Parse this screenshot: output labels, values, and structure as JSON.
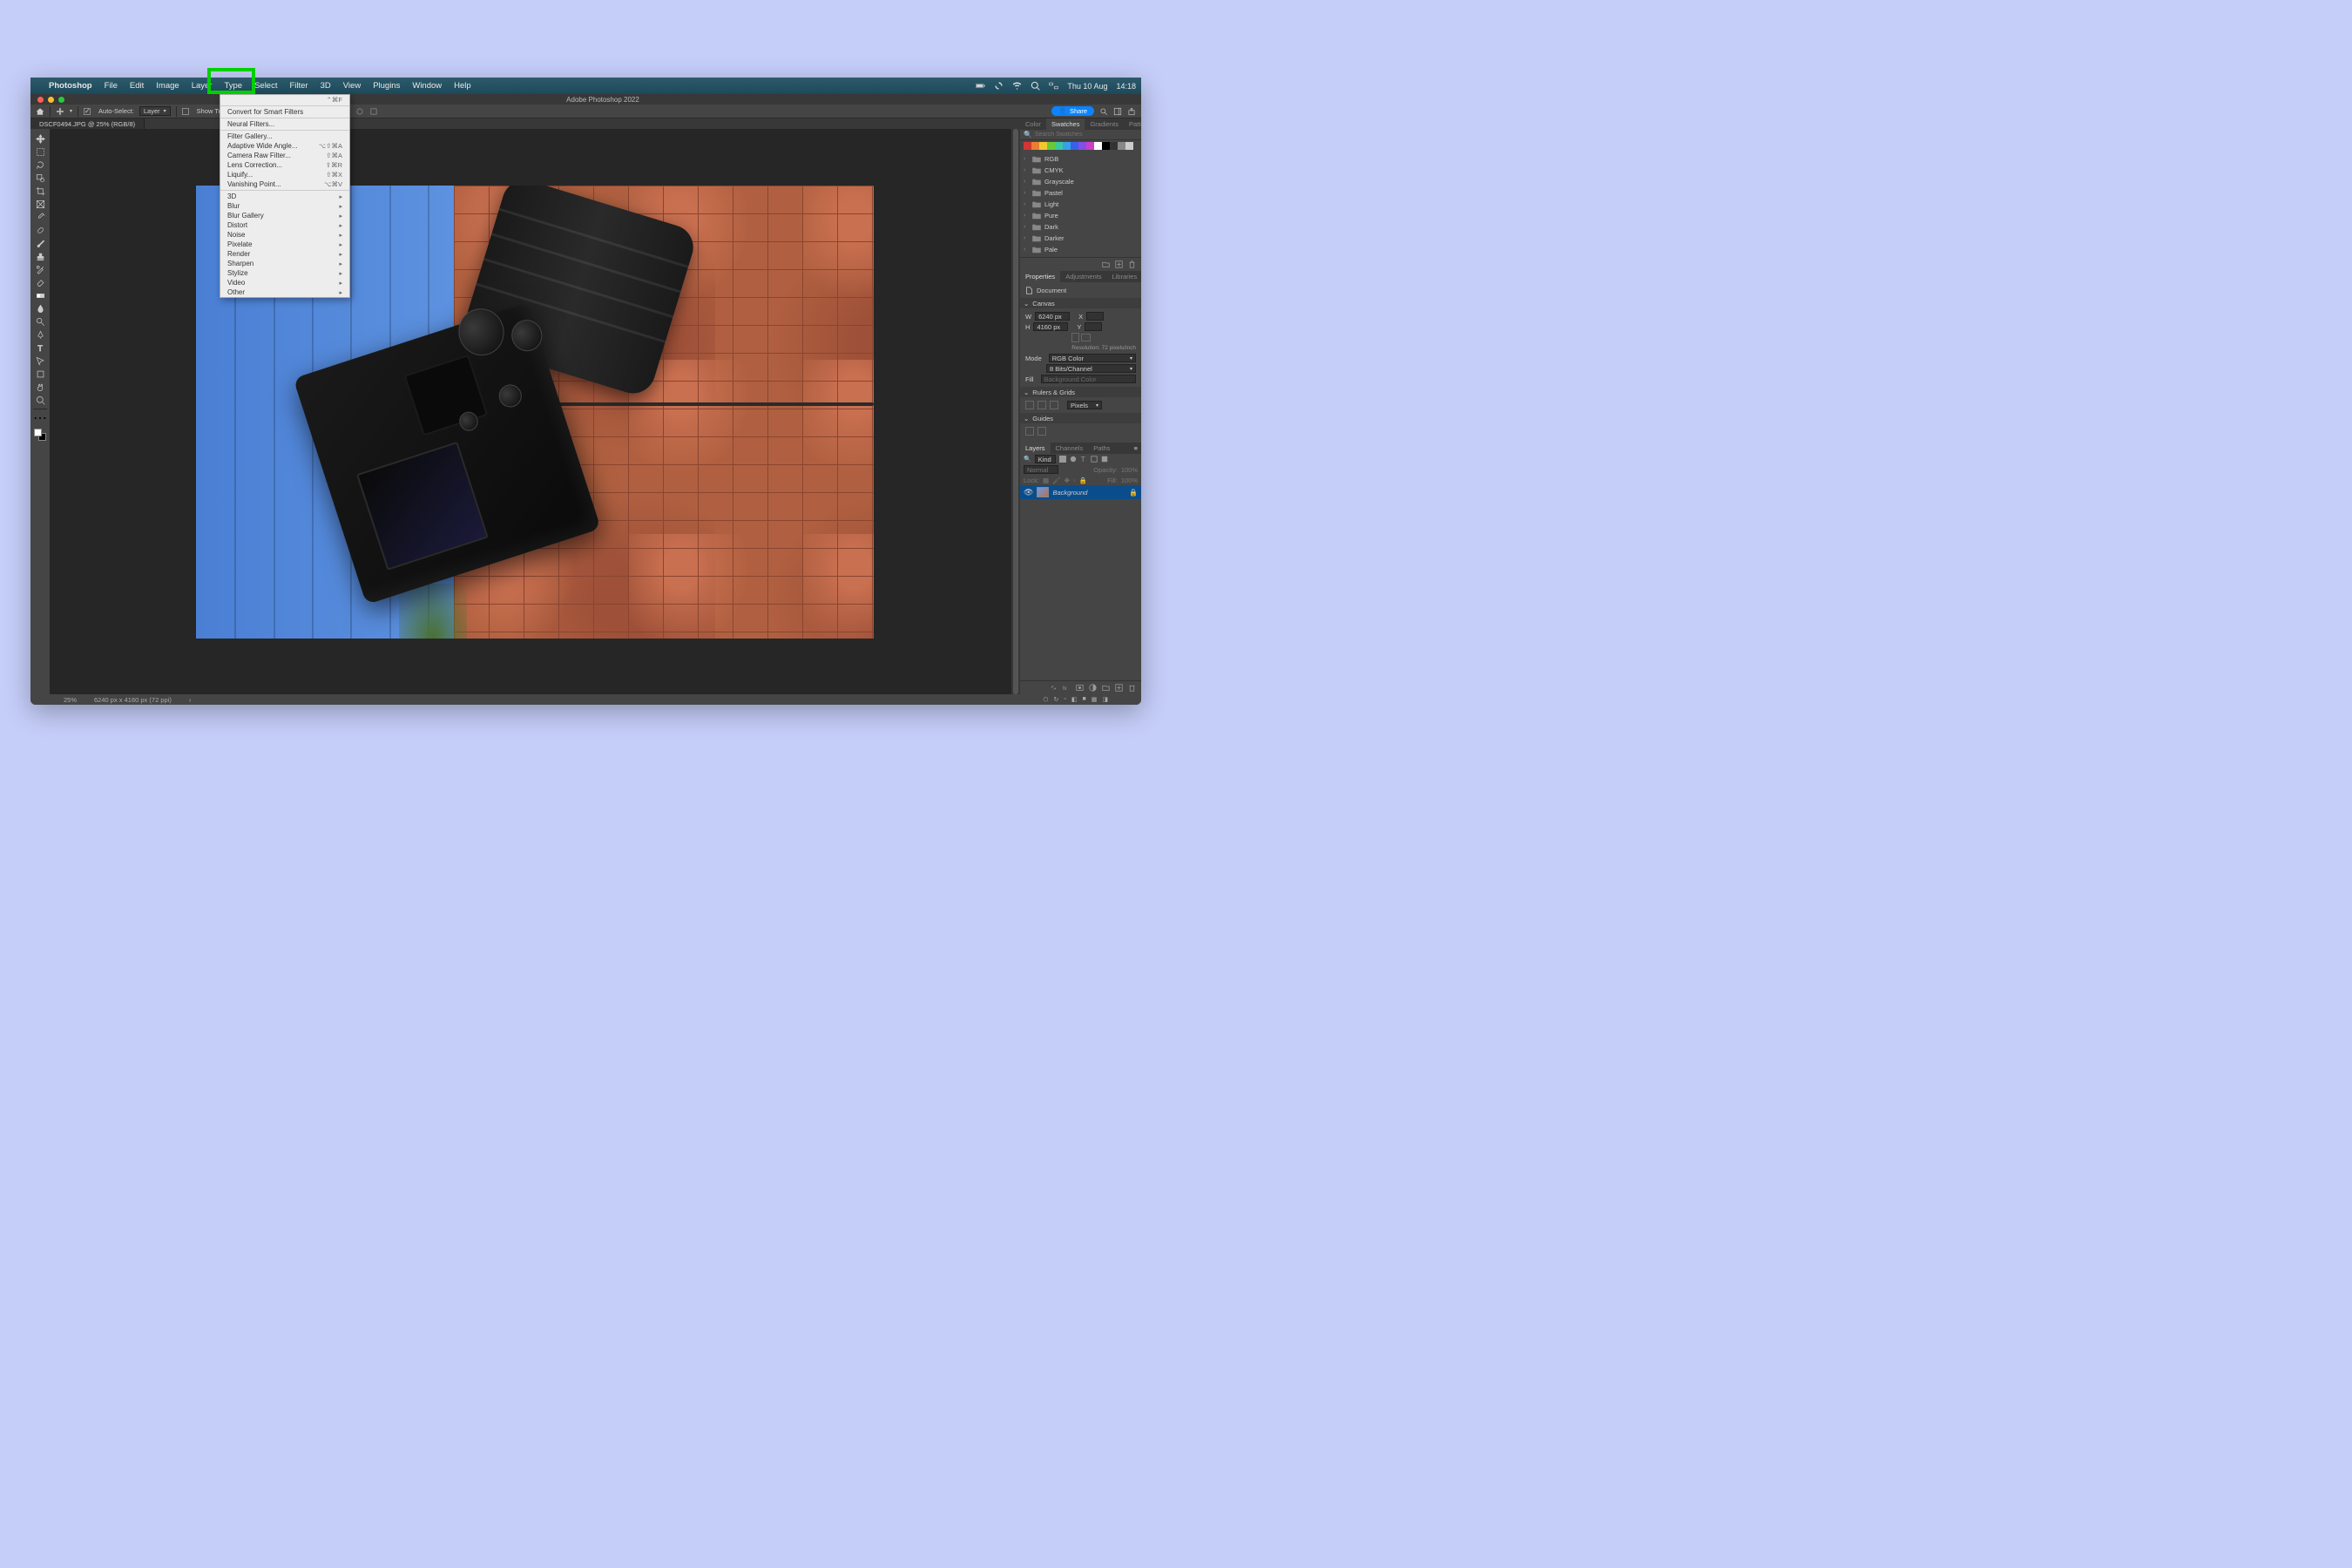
{
  "mac_menubar": {
    "app": "Photoshop",
    "items": [
      "File",
      "Edit",
      "Image",
      "Layer",
      "Type",
      "Select",
      "Filter",
      "3D",
      "View",
      "Plugins",
      "Window",
      "Help"
    ],
    "date": "Thu 10 Aug",
    "time": "14:18"
  },
  "window": {
    "title": "Adobe Photoshop 2022"
  },
  "options_bar": {
    "auto_select": "Auto-Select:",
    "auto_select_value": "Layer",
    "show_transform": "Show Transform Controls",
    "share": "Share"
  },
  "doc_tab": "DSCF0494.JPG @ 25% (RGB/8)",
  "filter_menu": {
    "top": {
      "label": "",
      "shortcut": "⌃⌘F"
    },
    "convert": "Convert for Smart Filters",
    "neural": "Neural Filters...",
    "group2": [
      {
        "label": "Filter Gallery..."
      },
      {
        "label": "Adaptive Wide Angle...",
        "shortcut": "⌥⇧⌘A"
      },
      {
        "label": "Camera Raw Filter...",
        "shortcut": "⇧⌘A"
      },
      {
        "label": "Lens Correction...",
        "shortcut": "⇧⌘R"
      },
      {
        "label": "Liquify...",
        "shortcut": "⇧⌘X"
      },
      {
        "label": "Vanishing Point...",
        "shortcut": "⌥⌘V"
      }
    ],
    "submenus": [
      "3D",
      "Blur",
      "Blur Gallery",
      "Distort",
      "Noise",
      "Pixelate",
      "Render",
      "Sharpen",
      "Stylize",
      "Video",
      "Other"
    ]
  },
  "swatches": {
    "tabs": [
      "Color",
      "Swatches",
      "Gradients",
      "Patterns"
    ],
    "search_placeholder": "Search Swatches",
    "row_colors": [
      "#d43535",
      "#e88030",
      "#f2c830",
      "#69c838",
      "#38c8a0",
      "#38a0e8",
      "#3860e8",
      "#8050e8",
      "#c840c8",
      "#ffffff",
      "#000000",
      "#333333",
      "#888888",
      "#cccccc"
    ],
    "folders": [
      "RGB",
      "CMYK",
      "Grayscale",
      "Pastel",
      "Light",
      "Pure",
      "Dark",
      "Darker",
      "Pale"
    ]
  },
  "properties": {
    "tabs": [
      "Properties",
      "Adjustments",
      "Libraries"
    ],
    "doc_label": "Document",
    "canvas_head": "Canvas",
    "w_label": "W",
    "w_value": "6240 px",
    "x_label": "X",
    "h_label": "H",
    "h_value": "4160 px",
    "y_label": "Y",
    "resolution": "Resolution: 72 pixels/inch",
    "mode_label": "Mode",
    "mode_value": "RGB Color",
    "bits": "8 Bits/Channel",
    "fill_label": "Fill",
    "fill_value": "Background Color",
    "rulers_head": "Rulers & Grids",
    "rulers_value": "Pixels",
    "guides_head": "Guides"
  },
  "layers": {
    "tabs": [
      "Layers",
      "Channels",
      "Paths"
    ],
    "kind_label": "Kind",
    "blend": "Normal",
    "opacity_label": "Opacity:",
    "opacity": "100%",
    "lock_label": "Lock:",
    "fill_label": "Fill:",
    "fill": "100%",
    "layer_name": "Background"
  },
  "status": {
    "zoom": "25%",
    "dims": "6240 px x 4160 px (72 ppi)"
  }
}
